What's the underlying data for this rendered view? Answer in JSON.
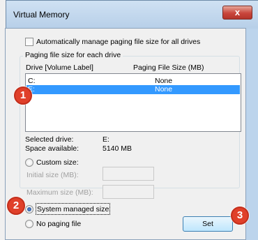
{
  "window": {
    "title": "Virtual Memory",
    "close_glyph": "x"
  },
  "auto_manage": {
    "label": "Automatically manage paging file size for all drives",
    "checked": false
  },
  "group": {
    "title": "Paging file size for each drive",
    "col_drive": "Drive  [Volume Label]",
    "col_size": "Paging File Size (MB)"
  },
  "drives": [
    {
      "drive": "C:",
      "size": "None",
      "selected": false
    },
    {
      "drive": "E:",
      "size": "None",
      "selected": true
    }
  ],
  "details": {
    "selected_drive_label": "Selected drive:",
    "selected_drive_value": "E:",
    "space_label": "Space available:",
    "space_value": "5140 MB"
  },
  "options": {
    "custom_size": "Custom size:",
    "initial_size": "Initial size (MB):",
    "maximum_size": "Maximum size (MB):",
    "system_managed": "System managed size",
    "no_paging": "No paging file",
    "selected": "system_managed"
  },
  "buttons": {
    "set": "Set"
  },
  "badges": [
    "1",
    "2",
    "3"
  ],
  "colors": {
    "selection": "#3399ff",
    "badge": "#e0402a"
  }
}
